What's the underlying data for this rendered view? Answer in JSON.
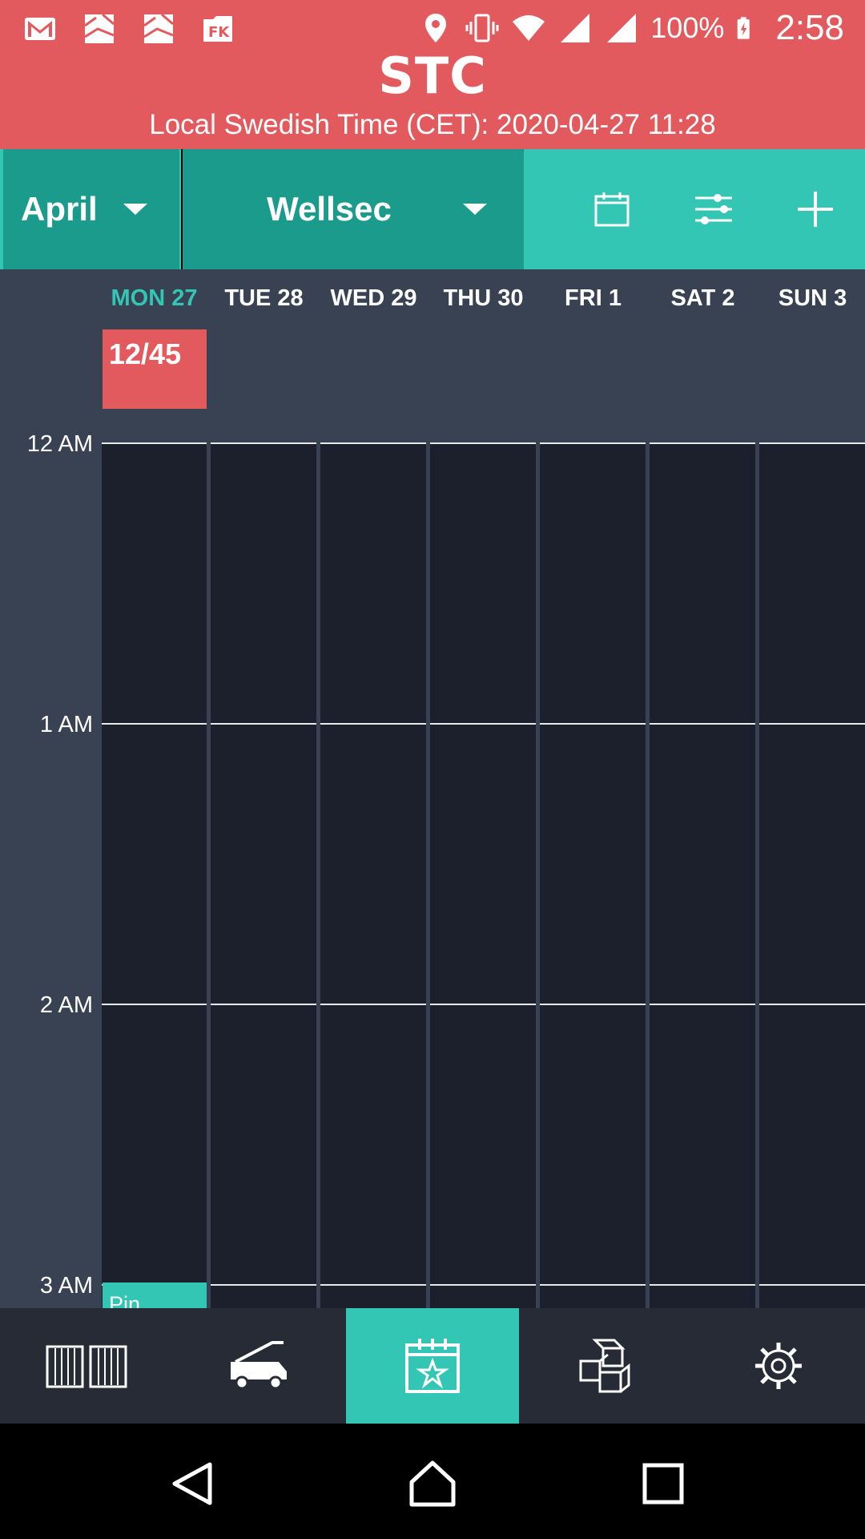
{
  "status_bar": {
    "battery": "100%",
    "time": "2:58",
    "icons": [
      "gmail-icon",
      "photo-icon",
      "photo-icon",
      "fk-app-icon",
      "location-icon",
      "vibrate-icon",
      "wifi-icon",
      "signal-icon",
      "signal-icon",
      "battery-charging-icon"
    ]
  },
  "header": {
    "title": "STC",
    "subtitle": "Local Swedish Time (CET): 2020-04-27 11:28"
  },
  "toolbar": {
    "month": "April",
    "site": "Wellsec",
    "actions": [
      "calendar-icon",
      "filter-sliders-icon",
      "add-icon"
    ]
  },
  "calendar": {
    "days": [
      "MON 27",
      "TUE 28",
      "WED 29",
      "THU 30",
      "FRI 1",
      "SAT 2",
      "SUN 3"
    ],
    "today_index": 0,
    "allday_badge": "12/45",
    "hours": [
      "12 AM",
      "1 AM",
      "2 AM",
      "3 AM"
    ],
    "event_label": "Pin"
  },
  "bottom_nav": {
    "items": [
      "gate-icon",
      "truck-crane-icon",
      "calendar-star-icon",
      "boxes-icon",
      "settings-gear-icon"
    ],
    "active_index": 2
  },
  "system_nav": [
    "back-icon",
    "home-icon",
    "recents-icon"
  ],
  "colors": {
    "header_red": "#e35a5e",
    "teal": "#33c6b5",
    "teal_dark": "#1b9b8b",
    "calendar_bg": "#384253",
    "grid_bg": "#1c202c",
    "nav_bg": "#262b35"
  }
}
